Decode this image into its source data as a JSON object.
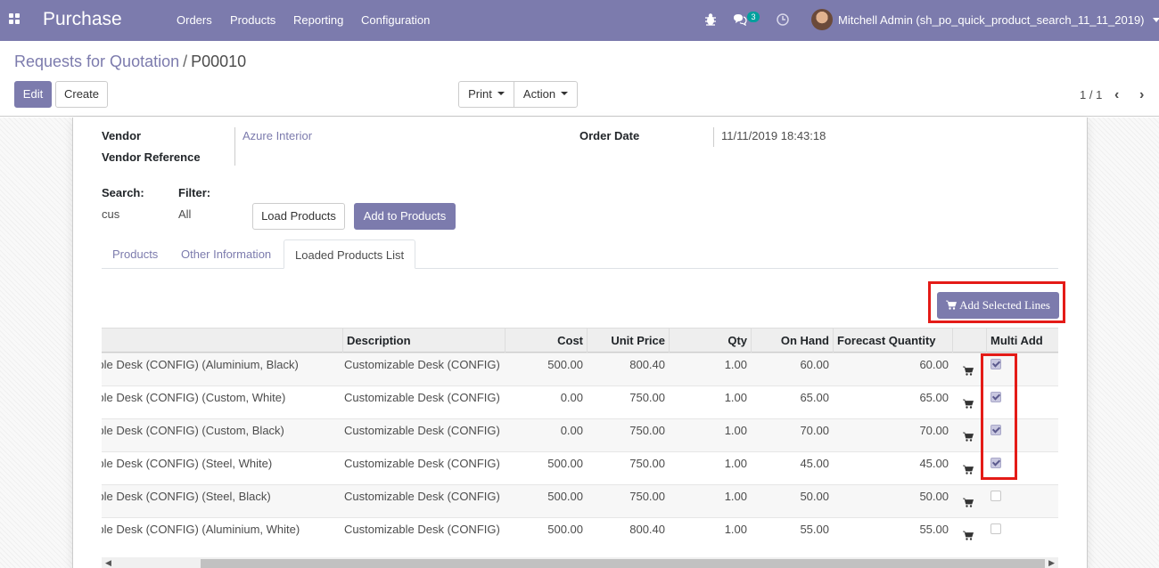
{
  "navbar": {
    "app_name": "Purchase",
    "menu": [
      "Orders",
      "Products",
      "Reporting",
      "Configuration"
    ],
    "chat_count": "3",
    "user": "Mitchell Admin (sh_po_quick_product_search_11_11_2019)",
    "color": "#7c7bad"
  },
  "breadcrumb": {
    "parent": "Requests for Quotation",
    "current": "P00010"
  },
  "buttons": {
    "edit": "Edit",
    "create": "Create",
    "print": "Print",
    "action": "Action",
    "load_products": "Load Products",
    "add_to_products": "Add to Products",
    "add_selected_lines": "Add Selected Lines"
  },
  "pager": {
    "value": "1 / 1"
  },
  "form": {
    "vendor_label": "Vendor",
    "vendor_value": "Azure Interior",
    "vendor_ref_label": "Vendor Reference",
    "order_date_label": "Order Date",
    "order_date_value": "11/11/2019 18:43:18",
    "search_label": "Search:",
    "search_value": "cus",
    "filter_label": "Filter:",
    "filter_value": "All"
  },
  "tabs": [
    "Products",
    "Other Information",
    "Loaded Products List"
  ],
  "table": {
    "headers": [
      "Description",
      "Cost",
      "Unit Price",
      "Qty",
      "On Hand",
      "Forecast Quantity",
      "Multi Add"
    ],
    "rows": [
      {
        "product": "Customizable Desk (CONFIG) (Aluminium, Black)",
        "description": "Customizable Desk (CONFIG)",
        "cost": "500.00",
        "unit_price": "800.40",
        "qty": "1.00",
        "on_hand": "60.00",
        "forecast": "60.00",
        "checked": true
      },
      {
        "product": "Customizable Desk (CONFIG) (Custom, White)",
        "description": "Customizable Desk (CONFIG)",
        "cost": "0.00",
        "unit_price": "750.00",
        "qty": "1.00",
        "on_hand": "65.00",
        "forecast": "65.00",
        "checked": true
      },
      {
        "product": "Customizable Desk (CONFIG) (Custom, Black)",
        "description": "Customizable Desk (CONFIG)",
        "cost": "0.00",
        "unit_price": "750.00",
        "qty": "1.00",
        "on_hand": "70.00",
        "forecast": "70.00",
        "checked": true
      },
      {
        "product": "Customizable Desk (CONFIG) (Steel, White)",
        "description": "Customizable Desk (CONFIG)",
        "cost": "500.00",
        "unit_price": "750.00",
        "qty": "1.00",
        "on_hand": "45.00",
        "forecast": "45.00",
        "checked": true
      },
      {
        "product": "Customizable Desk (CONFIG) (Steel, Black)",
        "description": "Customizable Desk (CONFIG)",
        "cost": "500.00",
        "unit_price": "750.00",
        "qty": "1.00",
        "on_hand": "50.00",
        "forecast": "50.00",
        "checked": false
      },
      {
        "product": "Customizable Desk (CONFIG) (Aluminium, White)",
        "description": "Customizable Desk (CONFIG)",
        "cost": "500.00",
        "unit_price": "800.40",
        "qty": "1.00",
        "on_hand": "55.00",
        "forecast": "55.00",
        "checked": false
      }
    ]
  },
  "colors": {
    "brand": "#7c7bad",
    "highlight": "#e41b17"
  }
}
